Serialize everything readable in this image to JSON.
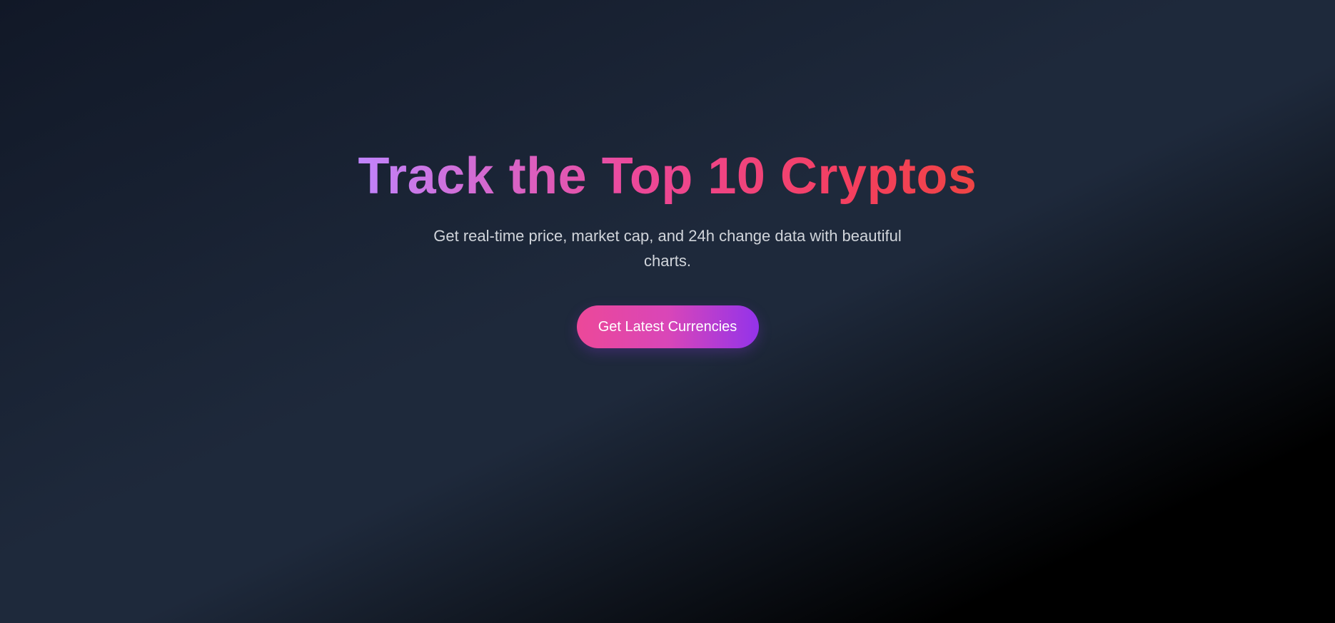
{
  "hero": {
    "title": "Track the Top 10 Cryptos",
    "subtitle": "Get real-time price, market cap, and 24h change data with beautiful charts.",
    "cta_label": "Get Latest Currencies"
  },
  "colors": {
    "background_start": "#111827",
    "background_mid": "#1e293b",
    "background_end": "#000000",
    "title_gradient_start": "#c084fc",
    "title_gradient_mid": "#ec4899",
    "title_gradient_end": "#ef4444",
    "button_gradient_start": "#ec4899",
    "button_gradient_end": "#9333ea",
    "subtitle_text": "#d1d5db",
    "button_text": "#ffffff"
  }
}
